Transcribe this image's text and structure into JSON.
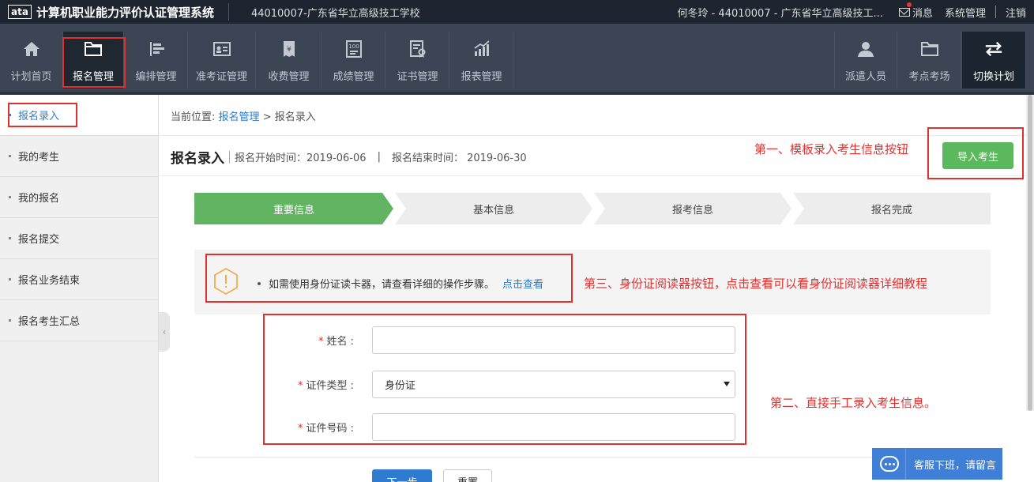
{
  "app": {
    "logo_text": "ata",
    "title": "计算机职业能力评价认证管理系统",
    "school": "44010007-广东省华立高级技工学校"
  },
  "topbar": {
    "user": "何冬玲 - 44010007 - 广东省华立高级技工...",
    "messages": "消息",
    "system": "系统管理",
    "logout": "注销"
  },
  "nav": {
    "items": [
      {
        "label": "计划首页",
        "icon": "home-icon"
      },
      {
        "label": "报名管理",
        "icon": "folder-icon"
      },
      {
        "label": "编排管理",
        "icon": "align-icon"
      },
      {
        "label": "准考证管理",
        "icon": "id-card-icon"
      },
      {
        "label": "收费管理",
        "icon": "fee-icon"
      },
      {
        "label": "成绩管理",
        "icon": "score-icon"
      },
      {
        "label": "证书管理",
        "icon": "certificate-icon"
      },
      {
        "label": "报表管理",
        "icon": "chart-icon"
      }
    ],
    "right": [
      {
        "label": "派遣人员",
        "icon": "person-icon"
      },
      {
        "label": "考点考场",
        "icon": "folder-icon"
      },
      {
        "label": "切换计划",
        "icon": "switch-icon"
      }
    ]
  },
  "sidebar": {
    "items": [
      {
        "label": "报名录入"
      },
      {
        "label": "我的考生"
      },
      {
        "label": "我的报名"
      },
      {
        "label": "报名提交"
      },
      {
        "label": "报名业务结束"
      },
      {
        "label": "报名考生汇总"
      }
    ]
  },
  "breadcrumb": {
    "prefix": "当前位置:",
    "parent": "报名管理",
    "sep": ">",
    "current": "报名录入"
  },
  "header": {
    "title": "报名录入",
    "start_label": "报名开始时间：2019-06-06",
    "divider": "|",
    "end_label": "报名结束时间： 2019-06-30",
    "import_button": "导入考生"
  },
  "steps": [
    "重要信息",
    "基本信息",
    "报考信息",
    "报名完成"
  ],
  "notice": {
    "text": "如需使用身份证读卡器，请查看详细的操作步骤。",
    "link": "点击查看"
  },
  "form": {
    "name_label": "姓名",
    "name_value": "",
    "idtype_label": "证件类型",
    "idtype_value": "身份证",
    "idno_label": "证件号码",
    "idno_value": "",
    "required_mark": "*",
    "colon": ":",
    "next_button": "下一步",
    "reset_button": "重置"
  },
  "annotations": {
    "first": "第一、模板录入考生信息按钮",
    "second": "第二、直接手工录入考生信息。",
    "third": "第三、身份证阅读器按钮，点击查看可以看身份证阅读器详细教程"
  },
  "customer_service": {
    "label": "客服下班，请留言"
  },
  "colors": {
    "accent": "#2f7bd0",
    "success": "#5cb85c",
    "annotation": "#e2302f",
    "nav_bg": "#3b4553"
  }
}
